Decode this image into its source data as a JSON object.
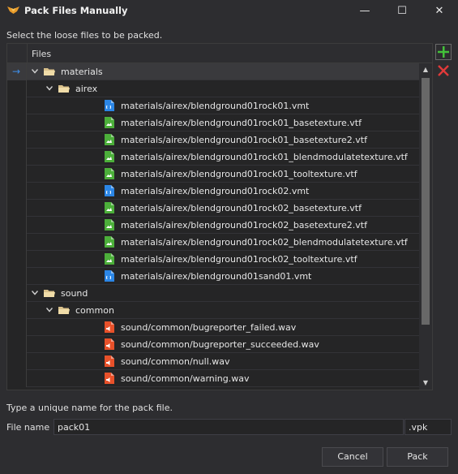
{
  "window": {
    "title": "Pack Files Manually",
    "minimize_glyph": "—",
    "maximize_glyph": "☐",
    "close_glyph": "✕"
  },
  "prompt": "Select the loose files to be packed.",
  "tree": {
    "column_header": "Files",
    "rows": [
      {
        "label": "materials",
        "kind": "folder",
        "level": 0,
        "expanded": true,
        "selected": true
      },
      {
        "label": "airex",
        "kind": "folder",
        "level": 1,
        "expanded": true
      },
      {
        "label": "materials/airex/blendground01rock01.vmt",
        "kind": "vmt",
        "level": 2
      },
      {
        "label": "materials/airex/blendground01rock01_basetexture.vtf",
        "kind": "vtf",
        "level": 2
      },
      {
        "label": "materials/airex/blendground01rock01_basetexture2.vtf",
        "kind": "vtf",
        "level": 2
      },
      {
        "label": "materials/airex/blendground01rock01_blendmodulatetexture.vtf",
        "kind": "vtf",
        "level": 2
      },
      {
        "label": "materials/airex/blendground01rock01_tooltexture.vtf",
        "kind": "vtf",
        "level": 2
      },
      {
        "label": "materials/airex/blendground01rock02.vmt",
        "kind": "vmt",
        "level": 2
      },
      {
        "label": "materials/airex/blendground01rock02_basetexture.vtf",
        "kind": "vtf",
        "level": 2
      },
      {
        "label": "materials/airex/blendground01rock02_basetexture2.vtf",
        "kind": "vtf",
        "level": 2
      },
      {
        "label": "materials/airex/blendground01rock02_blendmodulatetexture.vtf",
        "kind": "vtf",
        "level": 2
      },
      {
        "label": "materials/airex/blendground01rock02_tooltexture.vtf",
        "kind": "vtf",
        "level": 2
      },
      {
        "label": "materials/airex/blendground01sand01.vmt",
        "kind": "vmt",
        "level": 2
      },
      {
        "label": "sound",
        "kind": "folder",
        "level": 0,
        "expanded": true
      },
      {
        "label": "common",
        "kind": "folder",
        "level": 1,
        "expanded": true
      },
      {
        "label": "sound/common/bugreporter_failed.wav",
        "kind": "wav",
        "level": 2
      },
      {
        "label": "sound/common/bugreporter_succeeded.wav",
        "kind": "wav",
        "level": 2
      },
      {
        "label": "sound/common/null.wav",
        "kind": "wav",
        "level": 2
      },
      {
        "label": "sound/common/warning.wav",
        "kind": "wav",
        "level": 2
      }
    ]
  },
  "toolbar": {
    "add_icon": "add-files-icon",
    "remove_icon": "remove-files-icon"
  },
  "name_hint": "Type a unique name for the pack file.",
  "file_name": {
    "label": "File name",
    "value": "pack01",
    "extension": ".vpk"
  },
  "buttons": {
    "cancel": "Cancel",
    "pack": "Pack"
  },
  "colors": {
    "accent_blue": "#3e8ee8",
    "vmt_icon": "#2b86e6",
    "vtf_icon": "#4caf3a",
    "wav_icon": "#e8512a",
    "folder": "#d9c08a",
    "add_green": "#43c23a",
    "remove_red": "#e03a3a"
  }
}
